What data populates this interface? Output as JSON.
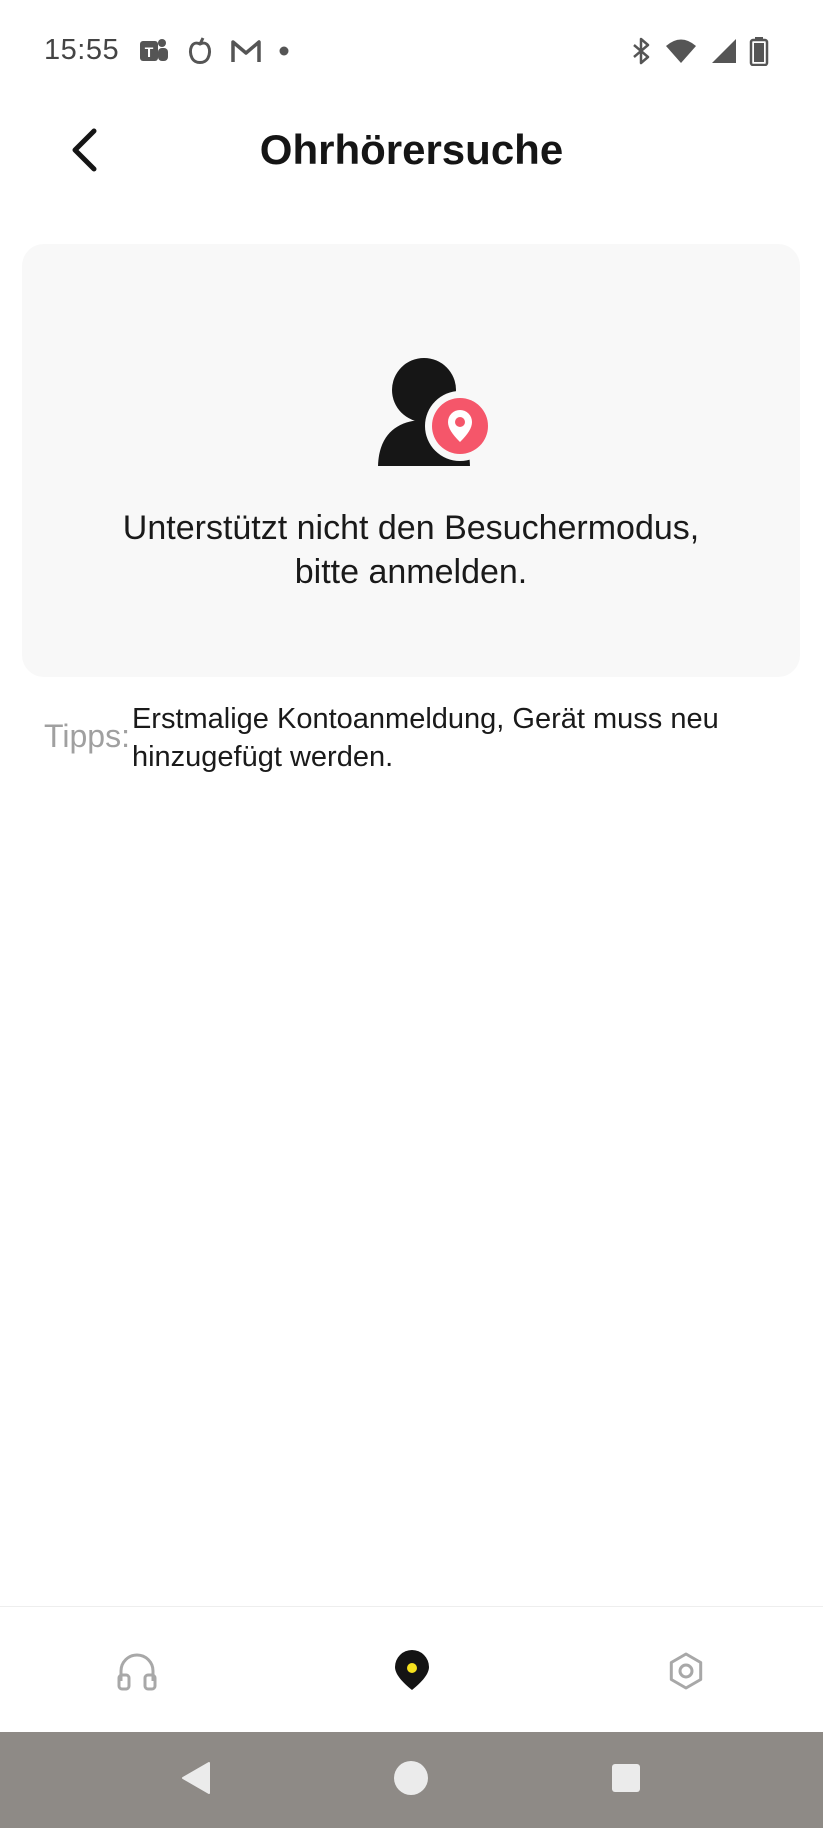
{
  "status_bar": {
    "time": "15:55",
    "left_icons": [
      "teams-icon",
      "app-icon",
      "gmail-icon",
      "dot-icon"
    ],
    "right_icons": [
      "bluetooth-icon",
      "wifi-icon",
      "signal-icon",
      "battery-icon"
    ]
  },
  "header": {
    "title": "Ohrhörersuche",
    "back_icon": "chevron-left-icon"
  },
  "card": {
    "icon": "user-location-icon",
    "message_line1": "Unterstützt nicht den Besuchermodus,",
    "message_line2": "bitte anmelden."
  },
  "tips": {
    "label": "Tipps:",
    "text": "Erstmalige Kontoanmeldung, Gerät muss neu hinzugefügt werden."
  },
  "bottom_nav": {
    "items": [
      {
        "icon": "headphones-icon",
        "active": false
      },
      {
        "icon": "location-pin-icon",
        "active": true
      },
      {
        "icon": "settings-icon",
        "active": false
      }
    ],
    "accent_color": "#f5e11e"
  },
  "colors": {
    "pin_accent": "#f5566a",
    "card_bg": "#f8f8f8",
    "system_nav_bg": "#8e8a86"
  }
}
